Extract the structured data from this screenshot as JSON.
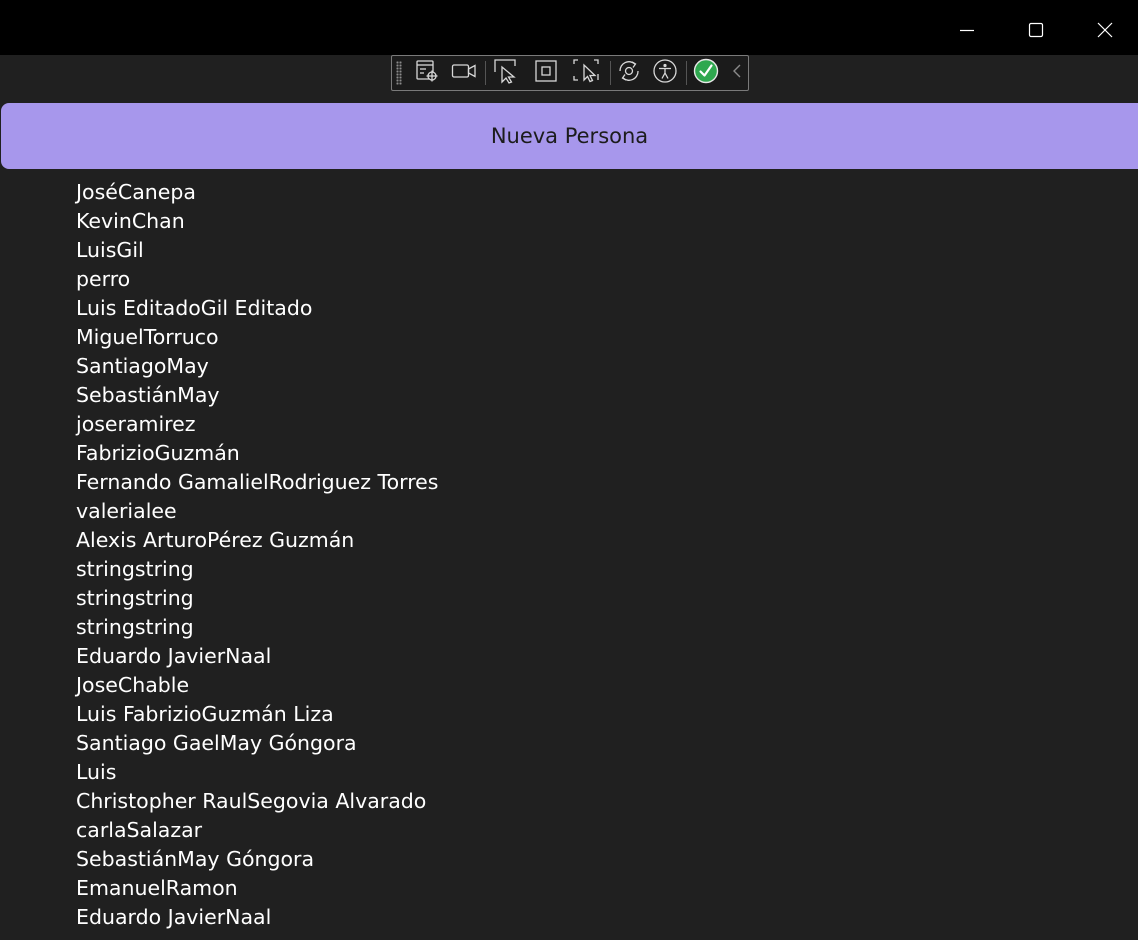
{
  "window": {
    "controls": {
      "minimize_icon": "minimize-icon",
      "maximize_icon": "maximize-icon",
      "close_icon": "close-icon"
    }
  },
  "dev_toolbar": {
    "icons": [
      "live-visual-tree-icon",
      "record-icon",
      "select-element-icon",
      "display-layout-adorners-icon",
      "track-focused-element-icon",
      "hot-reload-icon",
      "accessibility-icon",
      "checkmark-icon",
      "collapse-chevron-icon"
    ]
  },
  "header": {
    "new_person_label": "Nueva Persona"
  },
  "colors": {
    "background": "#202020",
    "titlebar": "#000000",
    "accent": "#a797ec",
    "text": "#ffffff",
    "check_green": "#2fa84f"
  },
  "people": [
    "JoséCanepa",
    "KevinChan",
    "LuisGil",
    "perro",
    "Luis EditadoGil Editado",
    "MiguelTorruco",
    "SantiagoMay",
    "SebastiánMay",
    "joseramirez",
    "FabrizioGuzmán",
    "Fernando GamalielRodriguez Torres",
    "valerialee",
    "Alexis ArturoPérez Guzmán",
    "stringstring",
    "stringstring",
    "stringstring",
    "Eduardo JavierNaal",
    "JoseChable",
    "Luis FabrizioGuzmán Liza",
    "Santiago GaelMay Góngora",
    "Luis",
    "Christopher RaulSegovia Alvarado",
    "carlaSalazar",
    "SebastiánMay Góngora",
    "EmanuelRamon",
    "Eduardo JavierNaal"
  ]
}
